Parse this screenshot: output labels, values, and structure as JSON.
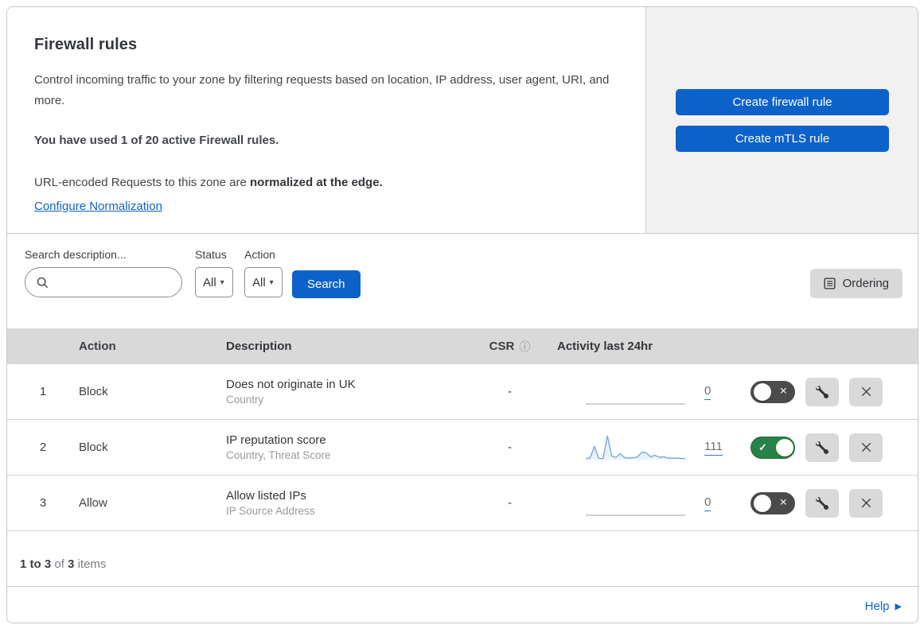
{
  "header": {
    "title": "Firewall rules",
    "description": "Control incoming traffic to your zone by filtering requests based on location, IP address, user agent, URI, and more.",
    "usage": "You have used 1 of 20 active Firewall rules.",
    "normalization_text": "URL-encoded Requests to this zone are ",
    "normalization_bold": "normalized at the edge.",
    "normalization_link": "Configure Normalization"
  },
  "actions": {
    "create_firewall_rule": "Create firewall rule",
    "create_mtls_rule": "Create mTLS rule"
  },
  "filters": {
    "search_label": "Search description...",
    "status_label": "Status",
    "status_value": "All",
    "action_label": "Action",
    "action_value": "All",
    "search_button": "Search",
    "ordering_button": "Ordering",
    "caret": "▾"
  },
  "table": {
    "columns": {
      "action": "Action",
      "description": "Description",
      "csr": "CSR",
      "csr_info": "ⓘ",
      "activity": "Activity last 24hr"
    },
    "rows": [
      {
        "index": "1",
        "action": "Block",
        "description": "Does not originate in UK",
        "criteria": "Country",
        "csr": "-",
        "count": "0",
        "enabled": false,
        "sparkline": [
          0,
          0,
          0,
          0,
          0,
          0,
          0,
          0,
          0,
          0,
          0,
          0,
          0,
          0,
          0,
          0,
          0,
          0,
          0,
          0,
          0,
          0,
          0,
          0
        ]
      },
      {
        "index": "2",
        "action": "Block",
        "description": "IP reputation score",
        "criteria": "Country, Threat Score",
        "csr": "-",
        "count": "111",
        "enabled": true,
        "sparkline": [
          4,
          8,
          55,
          6,
          4,
          100,
          15,
          10,
          25,
          8,
          6,
          8,
          12,
          32,
          28,
          12,
          18,
          10,
          12,
          7,
          6,
          7,
          5,
          4
        ]
      },
      {
        "index": "3",
        "action": "Allow",
        "description": "Allow listed IPs",
        "criteria": "IP Source Address",
        "csr": "-",
        "count": "0",
        "enabled": false,
        "sparkline": [
          0,
          0,
          0,
          0,
          0,
          0,
          0,
          0,
          0,
          0,
          0,
          0,
          0,
          0,
          0,
          0,
          0,
          0,
          0,
          0,
          0,
          0,
          0,
          0
        ]
      }
    ]
  },
  "toggle_glyphs": {
    "check": "✓",
    "cross": "×"
  },
  "footer": {
    "range": "1 to 3",
    "of": "of",
    "total": "3",
    "items": "items",
    "help": "Help",
    "help_arrow": "▶"
  },
  "colors": {
    "accent": "#0d62c9",
    "toggle_on": "#288246",
    "toggle_off": "#4b4b4e",
    "spark_line": "#76a9de",
    "spark_fill": "#e9f1fa",
    "spark_flat": "#b3b3b3"
  }
}
